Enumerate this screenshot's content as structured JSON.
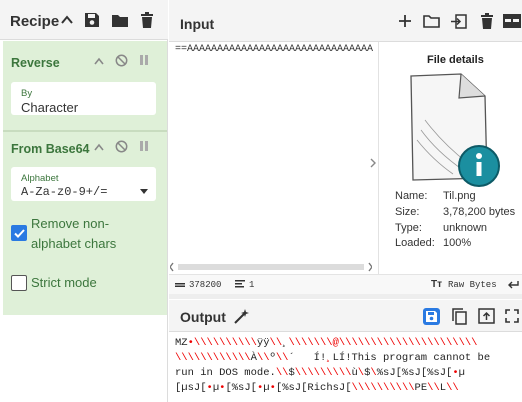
{
  "recipe": {
    "title": "Recipe",
    "operations": [
      {
        "name": "Reverse",
        "field_label": "By",
        "field_value": "Character"
      },
      {
        "name": "From Base64",
        "field_label": "Alphabet",
        "field_value": "A-Za-z0-9+/=",
        "options": [
          {
            "label": "Remove non-alphabet chars",
            "checked": true
          },
          {
            "label": "Strict mode",
            "checked": false
          }
        ]
      }
    ]
  },
  "input": {
    "title": "Input",
    "text": "==AAAAAAAAAAAAAAAAAAAAAAAAAAAAAAAAA",
    "file_details": {
      "title": "File details",
      "name_label": "Name:",
      "name_value": "Til.png",
      "size_label": "Size:",
      "size_value": "3,78,200 bytes",
      "type_label": "Type:",
      "type_value": "unknown",
      "loaded_label": "Loaded:",
      "loaded_value": "100%"
    },
    "status": {
      "length": "378200",
      "lines": "1",
      "encoding": "Raw Bytes"
    }
  },
  "output": {
    "title": "Output",
    "lines": [
      [
        [
          "MZ",
          0
        ],
        [
          "•\\\\\\\\\\\\\\\\\\\\",
          1
        ],
        [
          "ÿÿ",
          0
        ],
        [
          "\\\\",
          1
        ],
        [
          "¸",
          0
        ],
        [
          "\\\\\\\\\\\\\\@\\\\\\\\\\\\\\\\\\\\\\\\\\\\\\\\\\\\\\\\\\\\",
          1
        ]
      ],
      [
        [
          "\\\\\\\\\\\\\\\\\\\\\\\\",
          1
        ],
        [
          "À",
          0
        ],
        [
          "\\\\",
          1
        ],
        [
          "º",
          0
        ],
        [
          "\\\\",
          1
        ],
        [
          "´   Í!",
          0
        ],
        [
          "¸",
          1
        ],
        [
          "LÍ!This program cannot be",
          0
        ]
      ],
      [
        [
          "run in DOS mode.",
          0
        ],
        [
          "\\\\",
          1
        ],
        [
          "$",
          0
        ],
        [
          "\\\\\\\\\\\\\\\\\\",
          1
        ],
        [
          "ù",
          0
        ],
        [
          "\\",
          1
        ],
        [
          "$",
          0
        ],
        [
          "\\",
          1
        ],
        [
          "%sJ[%sJ[%sJ[",
          0
        ],
        [
          "•",
          1
        ],
        [
          "µ",
          0
        ]
      ],
      [
        [
          "[µsJ[",
          0
        ],
        [
          "•",
          1
        ],
        [
          "µ",
          0
        ],
        [
          "•",
          1
        ],
        [
          "[%sJ[",
          0
        ],
        [
          "•",
          1
        ],
        [
          "µ",
          0
        ],
        [
          "•",
          1
        ],
        [
          "[%sJ[RichsJ[",
          0
        ],
        [
          "\\\\\\\\\\\\\\\\\\\\",
          1
        ],
        [
          "PE",
          0
        ],
        [
          "\\\\",
          1
        ],
        [
          "L",
          0
        ],
        [
          "\\\\",
          1
        ]
      ]
    ]
  },
  "colors": {
    "accent": "#2a7ae2",
    "recipe_bg": "#dff0d8",
    "op_title": "#3c763d",
    "file_icon": "#1b8fa0"
  }
}
